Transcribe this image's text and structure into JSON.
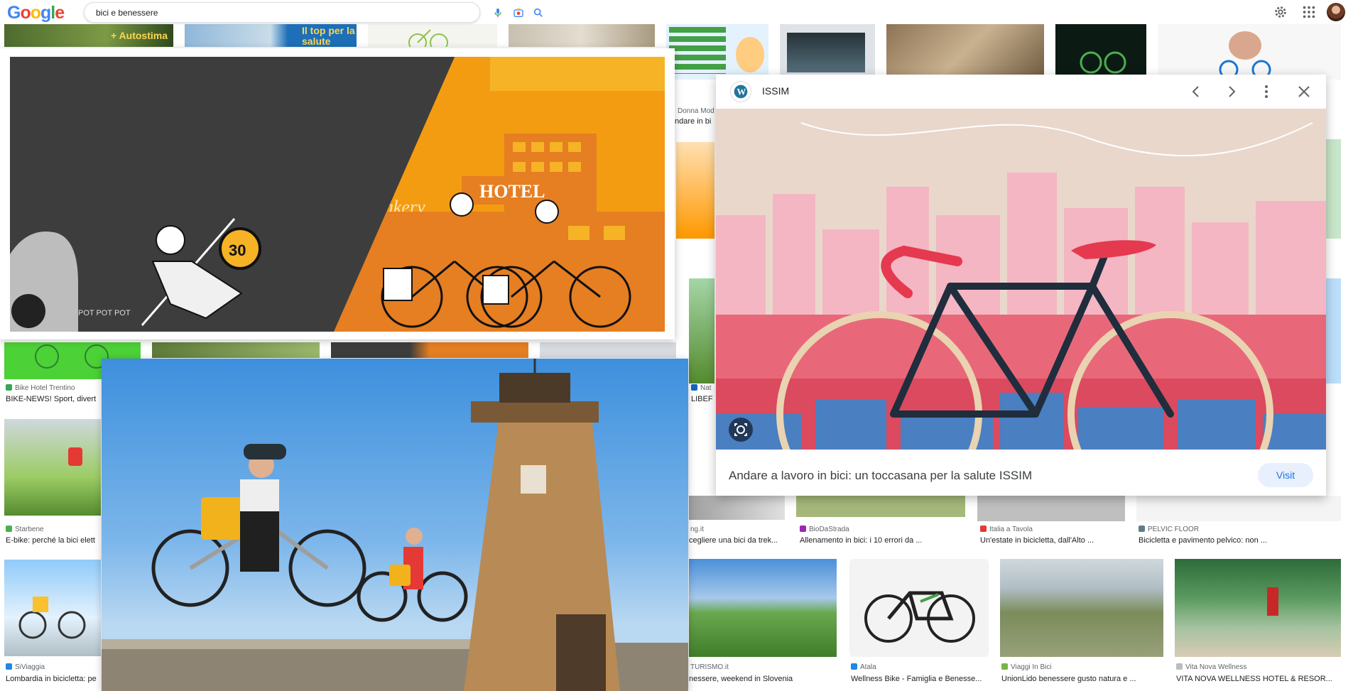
{
  "header": {
    "logo_letters": [
      "G",
      "o",
      "o",
      "g",
      "l",
      "e"
    ],
    "logo_colors": [
      "#4285F4",
      "#EA4335",
      "#FBBC05",
      "#4285F4",
      "#34A853",
      "#EA4335"
    ],
    "search_value": "bici e benessere",
    "icons": [
      "mic-icon",
      "camera-icon",
      "search-icon",
      "gear-icon",
      "apps-icon"
    ]
  },
  "colors": {
    "accent": "#1a73e8",
    "visit_bg": "#e8f0fe"
  },
  "results": [
    {
      "source": "Bike Hotel Trentino",
      "title": "BIKE-NEWS! Sport, divert",
      "fav": "#34a853"
    },
    {
      "source": "Starbene",
      "title": "E-bike: perché la bici elett",
      "fav": "#4caf50"
    },
    {
      "source": "SiViaggia",
      "title": "Lombardia in bicicletta: pe",
      "fav": "#1e88e5"
    },
    {
      "source": "Donna Mod",
      "title": "ndare in bi",
      "fav": "#888888"
    },
    {
      "source": "Nat",
      "title": "LIBEF",
      "fav": "#1565c0"
    },
    {
      "source": "ng.it",
      "title": "cegliere una bici da trek...",
      "fav": "#9e9e9e"
    },
    {
      "source": "BioDaStrada",
      "title": "Allenamento in bici: i 10 errori da ...",
      "fav": "#9c27b0"
    },
    {
      "source": "Italia a Tavola",
      "title": "Un'estate in bicicletta, dall'Alto ...",
      "fav": "#e53935"
    },
    {
      "source": "PELVIC FLOOR",
      "title": "Bicicletta e pavimento pelvico: non ...",
      "fav": "#607d8b"
    },
    {
      "source": "TURISMO.it",
      "title": "nessere, weekend in Slovenia",
      "fav": "#9e9e9e"
    },
    {
      "source": "Atala",
      "title": "Wellness Bike - Famiglia e Benesse...",
      "fav": "#1e88e5"
    },
    {
      "source": "Viaggi In Bici",
      "title": "UnionLido benessere gusto natura e ...",
      "fav": "#7cb342"
    },
    {
      "source": "Vita Nova Wellness",
      "title": "VITA NOVA WELLNESS HOTEL & RESOR...",
      "fav": "#bdbdbd"
    }
  ],
  "thumb_text": {
    "autostima": "+ Autostima",
    "top_salute": "Il top per la salute"
  },
  "illustration": {
    "hotel_sign": "HOTEL",
    "bakery_sign": "Bakery",
    "speed_sign": "30",
    "pot_text": "POT POT POT"
  },
  "preview": {
    "site": "ISSIM",
    "title": "Andare a lavoro in bici: un toccasana per la salute ISSIM",
    "visit_label": "Visit",
    "icons": [
      "wordpress-icon",
      "chevron-left-icon",
      "chevron-right-icon",
      "more-vert-icon",
      "close-icon",
      "lens-icon"
    ]
  }
}
